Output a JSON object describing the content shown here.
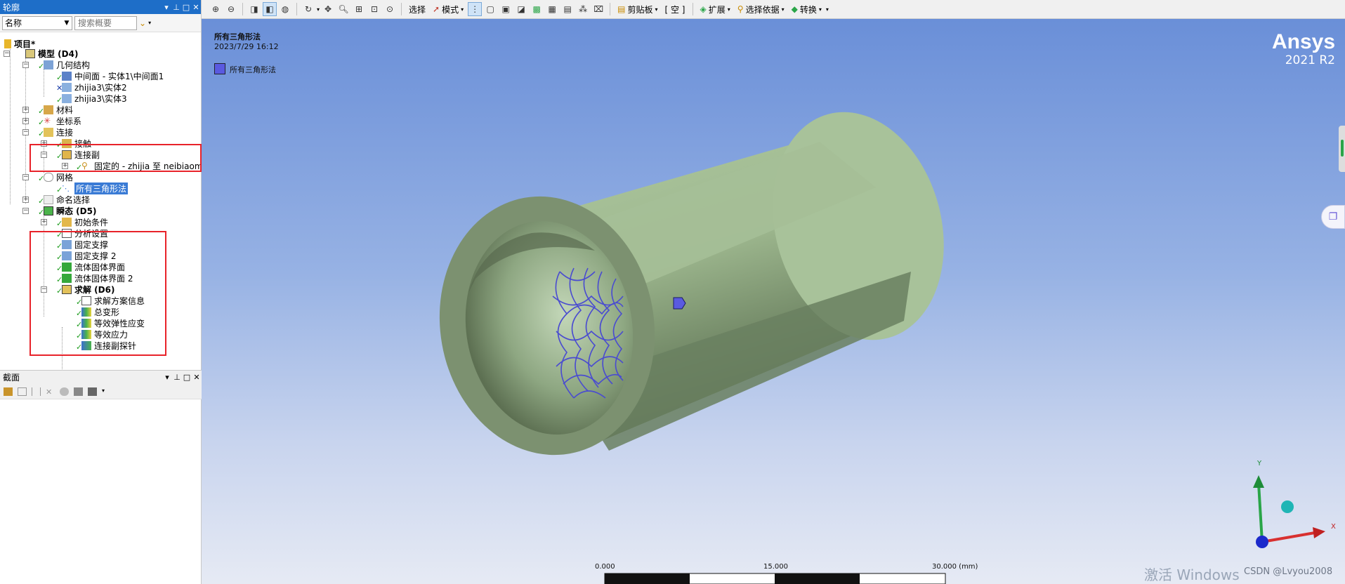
{
  "outline": {
    "title": "轮廓",
    "filter_select": "名称",
    "search_placeholder": "搜索概要",
    "tree": [
      {
        "label": "项目*"
      },
      {
        "label": "模型 (D4)"
      },
      {
        "label": "几何结构"
      },
      {
        "label": "中间面 - 实体1\\中间面1"
      },
      {
        "label": "zhijia3\\实体2"
      },
      {
        "label": "zhijia3\\实体3"
      },
      {
        "label": "材料"
      },
      {
        "label": "坐标系"
      },
      {
        "label": "连接"
      },
      {
        "label": "接触"
      },
      {
        "label": "连接副"
      },
      {
        "label": "固定的 - zhijia 至 neibiaomian"
      },
      {
        "label": "网格"
      },
      {
        "label": "所有三角形法"
      },
      {
        "label": "命名选择"
      },
      {
        "label": "瞬态 (D5)"
      },
      {
        "label": "初始条件"
      },
      {
        "label": "分析设置"
      },
      {
        "label": "固定支撑"
      },
      {
        "label": "固定支撑 2"
      },
      {
        "label": "流体固体界面"
      },
      {
        "label": "流体固体界面 2"
      },
      {
        "label": "求解 (D6)"
      },
      {
        "label": "求解方案信息"
      },
      {
        "label": "总变形"
      },
      {
        "label": "等效弹性应变"
      },
      {
        "label": "等效应力"
      },
      {
        "label": "连接副探针"
      }
    ]
  },
  "section_panel": {
    "title": "截面"
  },
  "toolbar": {
    "select": "选择",
    "mode": "模式",
    "clipboard": "剪贴板",
    "empty": "[ 空 ]",
    "extend": "扩展",
    "select_by": "选择依据",
    "convert": "转换"
  },
  "viewport": {
    "title": "所有三角形法",
    "date": "2023/7/29 16:12",
    "legend_label": "所有三角形法",
    "legend_color": "#5a5ae0",
    "brand": "Ansys",
    "version": "2021 R2",
    "scale": [
      "0.000",
      "15.000",
      "30.000 (mm)"
    ],
    "axis_x": "X",
    "axis_y": "Y",
    "watermark": "激活 Windows",
    "credit": "CSDN @Lvyou2008"
  },
  "colors": {
    "accent": "#1e6ec8",
    "highlight_box": "#e8232a",
    "model": "#a3c094"
  }
}
